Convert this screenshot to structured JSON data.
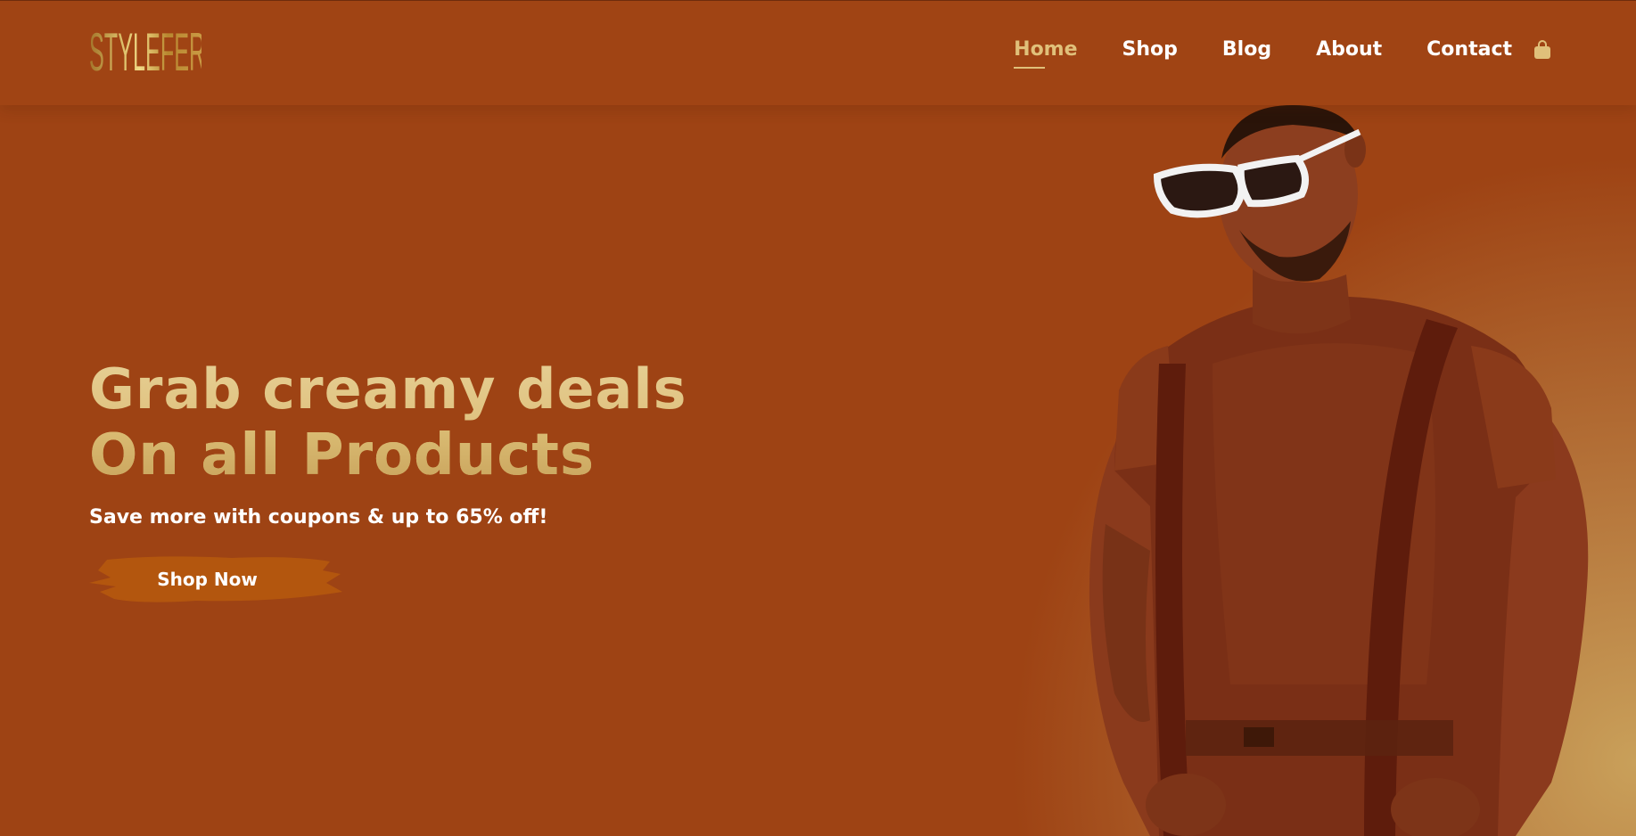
{
  "brand": {
    "logo_text": "STYLEFER"
  },
  "nav": {
    "items": [
      {
        "label": "Home",
        "active": true
      },
      {
        "label": "Shop",
        "active": false
      },
      {
        "label": "Blog",
        "active": false
      },
      {
        "label": "About",
        "active": false
      },
      {
        "label": "Contact",
        "active": false
      }
    ],
    "cart_icon": "shopping-bag-icon"
  },
  "hero": {
    "headline_line1": "Grab creamy deals",
    "headline_line2": "On all Products",
    "subtext": "Save more with coupons & up to 65% off!",
    "cta_label": "Shop Now",
    "image_alt": "Man in brown t-shirt with suspenders and white sunglasses"
  },
  "colors": {
    "background": "#9e4314",
    "accent_gold": "#d9b46a",
    "cta_brush": "#b3560e",
    "text_white": "#ffffff"
  }
}
